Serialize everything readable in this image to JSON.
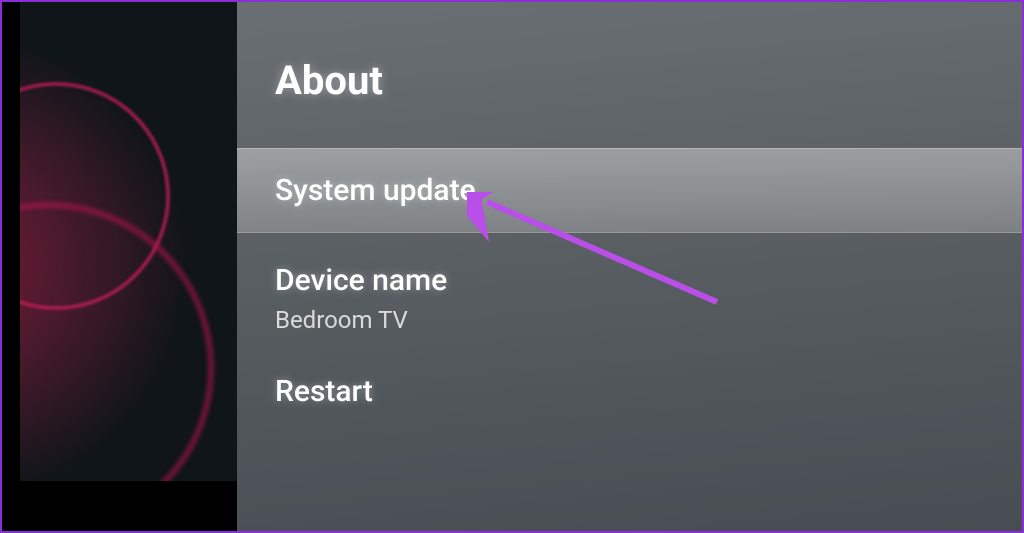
{
  "page": {
    "title": "About"
  },
  "menu": {
    "systemUpdate": {
      "label": "System update"
    },
    "deviceName": {
      "label": "Device name",
      "value": "Bedroom TV"
    },
    "restart": {
      "label": "Restart"
    }
  },
  "annotation": {
    "arrow_color": "#b94fe8"
  }
}
